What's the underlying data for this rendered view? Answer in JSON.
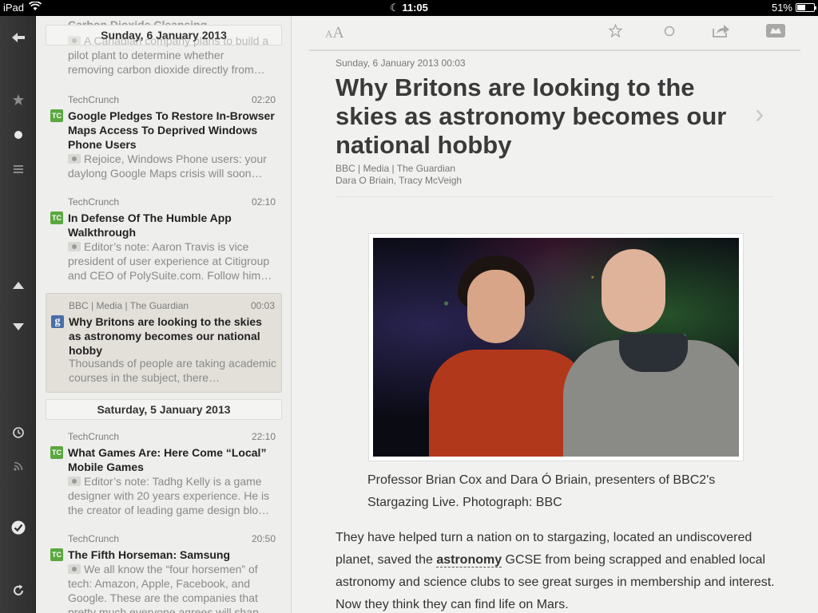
{
  "status": {
    "device": "iPad",
    "time": "11:05",
    "battery": "51%",
    "battery_level": 0.51
  },
  "toolbar": {
    "icons": [
      "back-arrow-icon",
      "star-icon",
      "dot-icon",
      "list-icon",
      "up-arrow-icon",
      "down-arrow-icon",
      "clock-icon",
      "rss-icon",
      "checkmark-icon",
      "refresh-icon"
    ]
  },
  "list": {
    "top_partial_title": "Carbon Dioxide Cleansing",
    "header1": "Sunday, 6 January 2013",
    "top_partial_summary_1": "A Canadian company plans to build a",
    "top_partial_summary_2": "pilot plant to determine whether",
    "top_partial_summary_3": "removing carbon dioxide directly from…",
    "items": [
      {
        "source": "TechCrunch",
        "time": "02:20",
        "favicon": "TC",
        "title": "Google Pledges To Restore In-Browser Maps Access To Deprived Windows Phone Users",
        "summary": "Rejoice, Windows Phone users: your daylong Google Maps crisis will soon…"
      },
      {
        "source": "TechCrunch",
        "time": "02:10",
        "favicon": "TC",
        "title": "In Defense Of The Humble App Walkthrough",
        "summary": "Editor’s note: Aaron Travis is vice president of user experience at Citigroup and CEO of PolySuite.com. Follow him…"
      },
      {
        "source": "BBC | Media | The Guardian",
        "time": "00:03",
        "favicon": "g",
        "title": "Why Britons are looking to the skies as astronomy becomes our national hobby",
        "summary": "Thousands of people are taking academic courses in the subject, there…"
      }
    ],
    "header2": "Saturday, 5 January 2013",
    "items2": [
      {
        "source": "TechCrunch",
        "time": "22:10",
        "favicon": "TC",
        "title": "What Games Are: Here Come “Local” Mobile Games",
        "summary": "Editor’s note: Tadhg Kelly is a game designer with 20 years experience. He is the creator of leading game design blo…"
      },
      {
        "source": "TechCrunch",
        "time": "20:50",
        "favicon": "TC",
        "title": "The Fifth Horseman: Samsung",
        "summary": "We all know the “four horsemen” of tech: Amazon, Apple, Facebook, and Google. These are the companies that pretty much everyone agrees will shap…"
      }
    ]
  },
  "reader": {
    "font_size_small": "A",
    "font_size_big": "A",
    "date": "Sunday, 6 January 2013 00:03",
    "title": "Why Britons are looking to the skies as astronomy becomes our national hobby",
    "source": "BBC | Media | The Guardian",
    "authors": "Dara O Briain, Tracy McVeigh",
    "caption": "Professor Brian Cox and Dara Ó Briain, presenters of BBC2's Stargazing Live. Photograph: BBC",
    "body_before": "They have helped turn a nation on to stargazing, located an undiscovered planet, saved the ",
    "body_keyword": "astronomy",
    "body_after": " GCSE from being scrapped and enabled local astronomy and science clubs to see great surges in membership and interest. Now they think they can find life on Mars."
  }
}
